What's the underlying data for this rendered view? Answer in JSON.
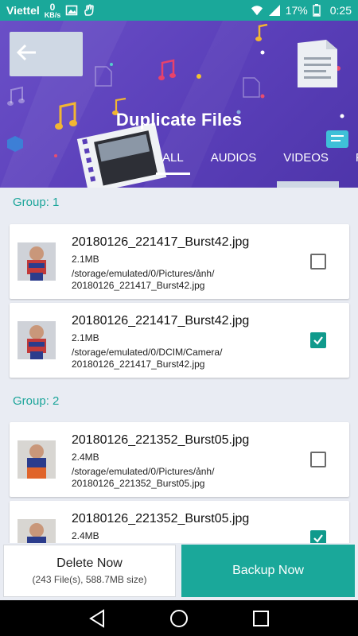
{
  "status_bar": {
    "carrier": "Viettel",
    "speed_value": "0",
    "speed_unit": "KB/s",
    "battery": "17%",
    "time": "0:25"
  },
  "header": {
    "title": "Duplicate Files",
    "tabs": [
      {
        "label": "ALL",
        "active": true
      },
      {
        "label": "AUDIOS",
        "active": false
      },
      {
        "label": "VIDEOS",
        "active": false
      },
      {
        "label": "P",
        "active": false
      }
    ]
  },
  "groups": [
    {
      "label": "Group: 1",
      "files": [
        {
          "name": "20180126_221417_Burst42.jpg",
          "size": "2.1MB",
          "path_line1": "/storage/emulated/0/Pictures/ảnh/",
          "path_line2": "20180126_221417_Burst42.jpg",
          "checked": false
        },
        {
          "name": "20180126_221417_Burst42.jpg",
          "size": "2.1MB",
          "path_line1": "/storage/emulated/0/DCIM/Camera/",
          "path_line2": "20180126_221417_Burst42.jpg",
          "checked": true
        }
      ]
    },
    {
      "label": "Group: 2",
      "files": [
        {
          "name": "20180126_221352_Burst05.jpg",
          "size": "2.4MB",
          "path_line1": "/storage/emulated/0/Pictures/ảnh/",
          "path_line2": "20180126_221352_Burst05.jpg",
          "checked": false
        },
        {
          "name": "20180126_221352_Burst05.jpg",
          "size": "2.4MB",
          "path_line1": "",
          "path_line2": "",
          "checked": true
        }
      ]
    }
  ],
  "actions": {
    "delete_label": "Delete Now",
    "delete_sub": "(243 File(s), 588.7MB size)",
    "backup_label": "Backup Now"
  },
  "colors": {
    "accent": "#1aa89a",
    "header_purple": "#5a3fb9"
  }
}
